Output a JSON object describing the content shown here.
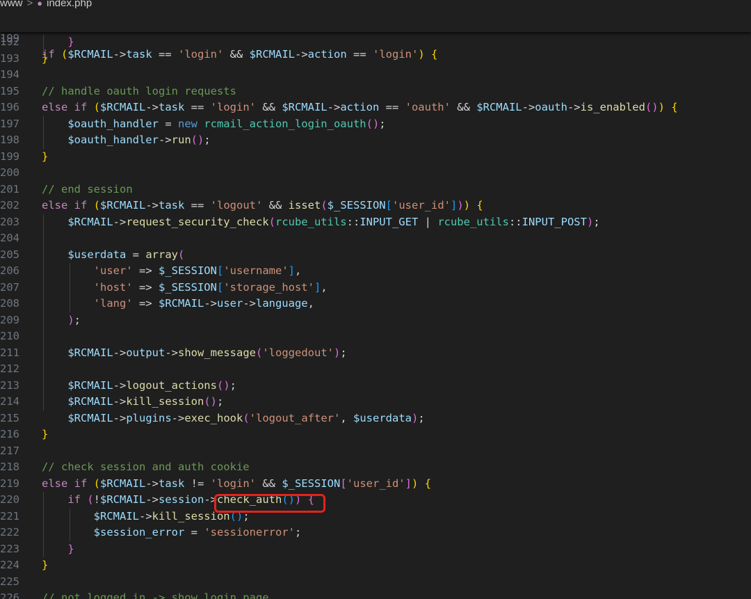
{
  "breadcrumb": {
    "folder": "www",
    "separator": ">",
    "file": "index.php"
  },
  "sticky_line": {
    "number": "199",
    "code": [
      [
        "ctl",
        "if "
      ],
      [
        "b1",
        "("
      ],
      [
        "var",
        "$RCMAIL"
      ],
      [
        "op",
        "->"
      ],
      [
        "var",
        "task"
      ],
      [
        "op",
        " == "
      ],
      [
        "str",
        "'login'"
      ],
      [
        "op",
        " && "
      ],
      [
        "var",
        "$RCMAIL"
      ],
      [
        "op",
        "->"
      ],
      [
        "var",
        "action"
      ],
      [
        "op",
        " == "
      ],
      [
        "str",
        "'login'"
      ],
      [
        "b1",
        ")"
      ],
      [
        "op",
        " "
      ],
      [
        "b1",
        "{"
      ]
    ]
  },
  "lines": [
    {
      "number": "192",
      "code": [
        [
          "op",
          "    "
        ],
        [
          "b2",
          "}"
        ]
      ]
    },
    {
      "number": "193",
      "code": [
        [
          "b1",
          "}"
        ]
      ]
    },
    {
      "number": "194",
      "code": []
    },
    {
      "number": "195",
      "code": [
        [
          "com",
          "// handle oauth login requests"
        ]
      ]
    },
    {
      "number": "196",
      "code": [
        [
          "ctl",
          "else if "
        ],
        [
          "b1",
          "("
        ],
        [
          "var",
          "$RCMAIL"
        ],
        [
          "op",
          "->"
        ],
        [
          "var",
          "task"
        ],
        [
          "op",
          " == "
        ],
        [
          "str",
          "'login'"
        ],
        [
          "op",
          " && "
        ],
        [
          "var",
          "$RCMAIL"
        ],
        [
          "op",
          "->"
        ],
        [
          "var",
          "action"
        ],
        [
          "op",
          " == "
        ],
        [
          "str",
          "'oauth'"
        ],
        [
          "op",
          " && "
        ],
        [
          "var",
          "$RCMAIL"
        ],
        [
          "op",
          "->"
        ],
        [
          "var",
          "oauth"
        ],
        [
          "op",
          "->"
        ],
        [
          "fn",
          "is_enabled"
        ],
        [
          "b2",
          "()"
        ],
        [
          "b1",
          ")"
        ],
        [
          "op",
          " "
        ],
        [
          "b1",
          "{"
        ]
      ]
    },
    {
      "number": "197",
      "code": [
        [
          "op",
          "    "
        ],
        [
          "var",
          "$oauth_handler"
        ],
        [
          "op",
          " = "
        ],
        [
          "kw",
          "new "
        ],
        [
          "cls",
          "rcmail_action_login_oauth"
        ],
        [
          "b2",
          "()"
        ],
        [
          "op",
          ";"
        ]
      ]
    },
    {
      "number": "198",
      "code": [
        [
          "op",
          "    "
        ],
        [
          "var",
          "$oauth_handler"
        ],
        [
          "op",
          "->"
        ],
        [
          "fn",
          "run"
        ],
        [
          "b2",
          "()"
        ],
        [
          "op",
          ";"
        ]
      ]
    },
    {
      "number": "199",
      "code": [
        [
          "b1",
          "}"
        ]
      ]
    },
    {
      "number": "200",
      "code": []
    },
    {
      "number": "201",
      "code": [
        [
          "com",
          "// end session"
        ]
      ]
    },
    {
      "number": "202",
      "code": [
        [
          "ctl",
          "else if "
        ],
        [
          "b1",
          "("
        ],
        [
          "var",
          "$RCMAIL"
        ],
        [
          "op",
          "->"
        ],
        [
          "var",
          "task"
        ],
        [
          "op",
          " == "
        ],
        [
          "str",
          "'logout'"
        ],
        [
          "op",
          " && "
        ],
        [
          "fn",
          "isset"
        ],
        [
          "b2",
          "("
        ],
        [
          "var",
          "$_SESSION"
        ],
        [
          "b3",
          "["
        ],
        [
          "str",
          "'user_id'"
        ],
        [
          "b3",
          "]"
        ],
        [
          "b2",
          ")"
        ],
        [
          "b1",
          ")"
        ],
        [
          "op",
          " "
        ],
        [
          "b1",
          "{"
        ]
      ]
    },
    {
      "number": "203",
      "code": [
        [
          "op",
          "    "
        ],
        [
          "var",
          "$RCMAIL"
        ],
        [
          "op",
          "->"
        ],
        [
          "fn",
          "request_security_check"
        ],
        [
          "b2",
          "("
        ],
        [
          "cls",
          "rcube_utils"
        ],
        [
          "op",
          "::"
        ],
        [
          "var",
          "INPUT_GET"
        ],
        [
          "op",
          " | "
        ],
        [
          "cls",
          "rcube_utils"
        ],
        [
          "op",
          "::"
        ],
        [
          "var",
          "INPUT_POST"
        ],
        [
          "b2",
          ")"
        ],
        [
          "op",
          ";"
        ]
      ]
    },
    {
      "number": "204",
      "code": []
    },
    {
      "number": "205",
      "code": [
        [
          "op",
          "    "
        ],
        [
          "var",
          "$userdata"
        ],
        [
          "op",
          " = "
        ],
        [
          "fn",
          "array"
        ],
        [
          "b2",
          "("
        ]
      ]
    },
    {
      "number": "206",
      "code": [
        [
          "op",
          "        "
        ],
        [
          "str",
          "'user'"
        ],
        [
          "op",
          " => "
        ],
        [
          "var",
          "$_SESSION"
        ],
        [
          "b3",
          "["
        ],
        [
          "str",
          "'username'"
        ],
        [
          "b3",
          "]"
        ],
        [
          "op",
          ","
        ]
      ]
    },
    {
      "number": "207",
      "code": [
        [
          "op",
          "        "
        ],
        [
          "str",
          "'host'"
        ],
        [
          "op",
          " => "
        ],
        [
          "var",
          "$_SESSION"
        ],
        [
          "b3",
          "["
        ],
        [
          "str",
          "'storage_host'"
        ],
        [
          "b3",
          "]"
        ],
        [
          "op",
          ","
        ]
      ]
    },
    {
      "number": "208",
      "code": [
        [
          "op",
          "        "
        ],
        [
          "str",
          "'lang'"
        ],
        [
          "op",
          " => "
        ],
        [
          "var",
          "$RCMAIL"
        ],
        [
          "op",
          "->"
        ],
        [
          "var",
          "user"
        ],
        [
          "op",
          "->"
        ],
        [
          "var",
          "language"
        ],
        [
          "op",
          ","
        ]
      ]
    },
    {
      "number": "209",
      "code": [
        [
          "op",
          "    "
        ],
        [
          "b2",
          ")"
        ],
        [
          "op",
          ";"
        ]
      ]
    },
    {
      "number": "210",
      "code": []
    },
    {
      "number": "211",
      "code": [
        [
          "op",
          "    "
        ],
        [
          "var",
          "$RCMAIL"
        ],
        [
          "op",
          "->"
        ],
        [
          "var",
          "output"
        ],
        [
          "op",
          "->"
        ],
        [
          "fn",
          "show_message"
        ],
        [
          "b2",
          "("
        ],
        [
          "str",
          "'loggedout'"
        ],
        [
          "b2",
          ")"
        ],
        [
          "op",
          ";"
        ]
      ]
    },
    {
      "number": "212",
      "code": []
    },
    {
      "number": "213",
      "code": [
        [
          "op",
          "    "
        ],
        [
          "var",
          "$RCMAIL"
        ],
        [
          "op",
          "->"
        ],
        [
          "fn",
          "logout_actions"
        ],
        [
          "b2",
          "()"
        ],
        [
          "op",
          ";"
        ]
      ]
    },
    {
      "number": "214",
      "code": [
        [
          "op",
          "    "
        ],
        [
          "var",
          "$RCMAIL"
        ],
        [
          "op",
          "->"
        ],
        [
          "fn",
          "kill_session"
        ],
        [
          "b2",
          "()"
        ],
        [
          "op",
          ";"
        ]
      ]
    },
    {
      "number": "215",
      "code": [
        [
          "op",
          "    "
        ],
        [
          "var",
          "$RCMAIL"
        ],
        [
          "op",
          "->"
        ],
        [
          "var",
          "plugins"
        ],
        [
          "op",
          "->"
        ],
        [
          "fn",
          "exec_hook"
        ],
        [
          "b2",
          "("
        ],
        [
          "str",
          "'logout_after'"
        ],
        [
          "op",
          ", "
        ],
        [
          "var",
          "$userdata"
        ],
        [
          "b2",
          ")"
        ],
        [
          "op",
          ";"
        ]
      ]
    },
    {
      "number": "216",
      "code": [
        [
          "b1",
          "}"
        ]
      ]
    },
    {
      "number": "217",
      "code": []
    },
    {
      "number": "218",
      "code": [
        [
          "com",
          "// check session and auth cookie"
        ]
      ]
    },
    {
      "number": "219",
      "code": [
        [
          "ctl",
          "else if "
        ],
        [
          "b1",
          "("
        ],
        [
          "var",
          "$RCMAIL"
        ],
        [
          "op",
          "->"
        ],
        [
          "var",
          "task"
        ],
        [
          "op",
          " != "
        ],
        [
          "str",
          "'login'"
        ],
        [
          "op",
          " && "
        ],
        [
          "var",
          "$_SESSION"
        ],
        [
          "b2",
          "["
        ],
        [
          "str",
          "'user_id'"
        ],
        [
          "b2",
          "]"
        ],
        [
          "b1",
          ")"
        ],
        [
          "op",
          " "
        ],
        [
          "b1",
          "{"
        ]
      ]
    },
    {
      "number": "220",
      "code": [
        [
          "op",
          "    "
        ],
        [
          "ctl",
          "if "
        ],
        [
          "b2",
          "("
        ],
        [
          "op",
          "!"
        ],
        [
          "var",
          "$RCMAIL"
        ],
        [
          "op",
          "->"
        ],
        [
          "var",
          "session"
        ],
        [
          "op",
          "->"
        ],
        [
          "fn",
          "check_auth"
        ],
        [
          "b3",
          "()"
        ],
        [
          "b2",
          ")"
        ],
        [
          "op",
          " "
        ],
        [
          "b2",
          "{"
        ]
      ]
    },
    {
      "number": "221",
      "code": [
        [
          "op",
          "        "
        ],
        [
          "var",
          "$RCMAIL"
        ],
        [
          "op",
          "->"
        ],
        [
          "fn",
          "kill_session"
        ],
        [
          "b3",
          "()"
        ],
        [
          "op",
          ";"
        ]
      ]
    },
    {
      "number": "222",
      "code": [
        [
          "op",
          "        "
        ],
        [
          "var",
          "$session_error"
        ],
        [
          "op",
          " = "
        ],
        [
          "str",
          "'sessionerror'"
        ],
        [
          "op",
          ";"
        ]
      ]
    },
    {
      "number": "223",
      "code": [
        [
          "op",
          "    "
        ],
        [
          "b2",
          "}"
        ]
      ]
    },
    {
      "number": "224",
      "code": [
        [
          "b1",
          "}"
        ]
      ]
    },
    {
      "number": "225",
      "code": []
    },
    {
      "number": "226",
      "code": [
        [
          "com",
          "// not logged in -> show login page"
        ]
      ]
    }
  ]
}
